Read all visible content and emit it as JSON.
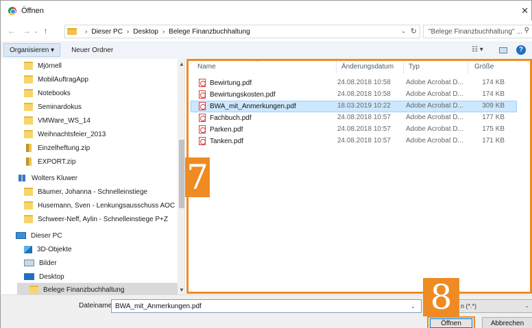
{
  "window": {
    "title": "Öffnen",
    "close_glyph": "✕"
  },
  "address": {
    "crumbs": [
      "Dieser PC",
      "Desktop",
      "Belege Finanzbuchhaltung"
    ],
    "search_placeholder": "\"Belege Finanzbuchhaltung\" ..."
  },
  "toolbar": {
    "organize_label": "Organisieren ▾",
    "new_folder_label": "Neuer Ordner"
  },
  "nav": {
    "items": [
      {
        "label": "Mjörnell",
        "icon": "folder-icon"
      },
      {
        "label": "MobilAuftragApp",
        "icon": "folder-icon"
      },
      {
        "label": "Notebooks",
        "icon": "folder-icon"
      },
      {
        "label": "Seminardokus",
        "icon": "folder-icon"
      },
      {
        "label": "VMWare_WS_14",
        "icon": "folder-icon"
      },
      {
        "label": "Weihnachtsfeier_2013",
        "icon": "folder-icon"
      },
      {
        "label": "Einzelheftung.zip",
        "icon": "zip-icon"
      },
      {
        "label": "EXPORT.zip",
        "icon": "zip-icon"
      },
      {
        "label": "Wolters Kluwer",
        "icon": "network-icon"
      },
      {
        "label": "Bäumer, Johanna - Schnelleinstiege",
        "icon": "folder-icon"
      },
      {
        "label": "Husemann, Sven - Lenkungsausschuss AOC",
        "icon": "folder-icon"
      },
      {
        "label": "Schweer-Neff, Aylin - Schnelleinstiege P+Z",
        "icon": "folder-icon"
      },
      {
        "label": "Dieser PC",
        "icon": "computer-icon"
      },
      {
        "label": "3D-Objekte",
        "icon": "3d-objects-icon"
      },
      {
        "label": "Bilder",
        "icon": "pictures-icon"
      },
      {
        "label": "Desktop",
        "icon": "desktop-icon"
      },
      {
        "label": "Belege Finanzbuchhaltung",
        "icon": "folder-icon"
      }
    ]
  },
  "columns": {
    "name": "Name",
    "date": "Änderungsdatum",
    "type": "Typ",
    "size": "Größe"
  },
  "files": [
    {
      "name": "Bewirtung.pdf",
      "date": "24.08.2018 10:58",
      "type": "Adobe Acrobat D...",
      "size": "174 KB"
    },
    {
      "name": "Bewirtungskosten.pdf",
      "date": "24.08.2018 10:58",
      "type": "Adobe Acrobat D...",
      "size": "174 KB"
    },
    {
      "name": "BWA_mit_Anmerkungen.pdf",
      "date": "18.03.2019 10:22",
      "type": "Adobe Acrobat D...",
      "size": "309 KB"
    },
    {
      "name": "Fachbuch.pdf",
      "date": "24.08.2018 10:57",
      "type": "Adobe Acrobat D...",
      "size": "177 KB"
    },
    {
      "name": "Parken.pdf",
      "date": "24.08.2018 10:57",
      "type": "Adobe Acrobat D...",
      "size": "175 KB"
    },
    {
      "name": "Tanken.pdf",
      "date": "24.08.2018 10:57",
      "type": "Adobe Acrobat D...",
      "size": "171 KB"
    }
  ],
  "bottom": {
    "filename_label": "Dateiname:",
    "filename_value": "BWA_mit_Anmerkungen.pdf",
    "filetype_value": "n (*.*)",
    "open_label": "Öffnen",
    "cancel_label": "Abbrechen"
  },
  "markers": {
    "step7": "7",
    "step8": "8"
  },
  "colors": {
    "highlight": "#ef8b22",
    "selection": "#cce8ff"
  }
}
